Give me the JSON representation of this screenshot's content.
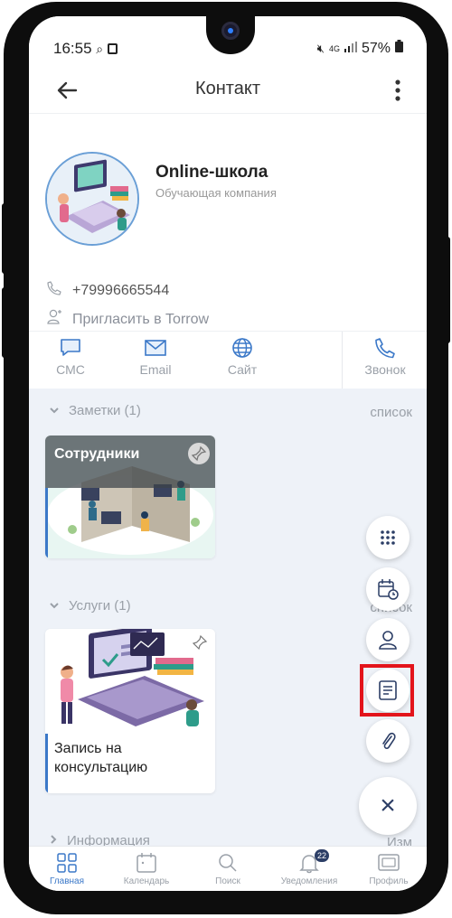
{
  "status_bar": {
    "time": "16:55",
    "network": "4G",
    "battery": "57%"
  },
  "topbar": {
    "title": "Контакт"
  },
  "profile": {
    "name": "Online-школа",
    "subtitle": "Обучающая компания",
    "phone": "+79996665544",
    "invite": "Пригласить в Torrow"
  },
  "actions": [
    {
      "label": "СМС",
      "icon": "chat-icon"
    },
    {
      "label": "Email",
      "icon": "mail-icon"
    },
    {
      "label": "Сайт",
      "icon": "globe-icon"
    },
    {
      "label": "Звонок",
      "icon": "phone-icon"
    }
  ],
  "sections": {
    "notes": {
      "title": "Заметки (1)",
      "link": "список",
      "card_title": "Сотрудники"
    },
    "services": {
      "title": "Услуги (1)",
      "link": "список",
      "card_title": "Запись на консультацию"
    },
    "info": {
      "title": "Информация",
      "link": "Изм"
    }
  },
  "fab": {
    "close_label": "×"
  },
  "bottom_nav": [
    {
      "label": "Главная",
      "icon": "home-grid-icon"
    },
    {
      "label": "Календарь",
      "icon": "calendar-icon"
    },
    {
      "label": "Поиск",
      "icon": "search-icon"
    },
    {
      "label": "Уведомления",
      "icon": "bell-icon",
      "badge": "22"
    },
    {
      "label": "Профиль",
      "icon": "profile-card-icon"
    }
  ],
  "colors": {
    "accent": "#3b78c8",
    "highlight": "#e3141b",
    "background": "#eef2f8"
  }
}
